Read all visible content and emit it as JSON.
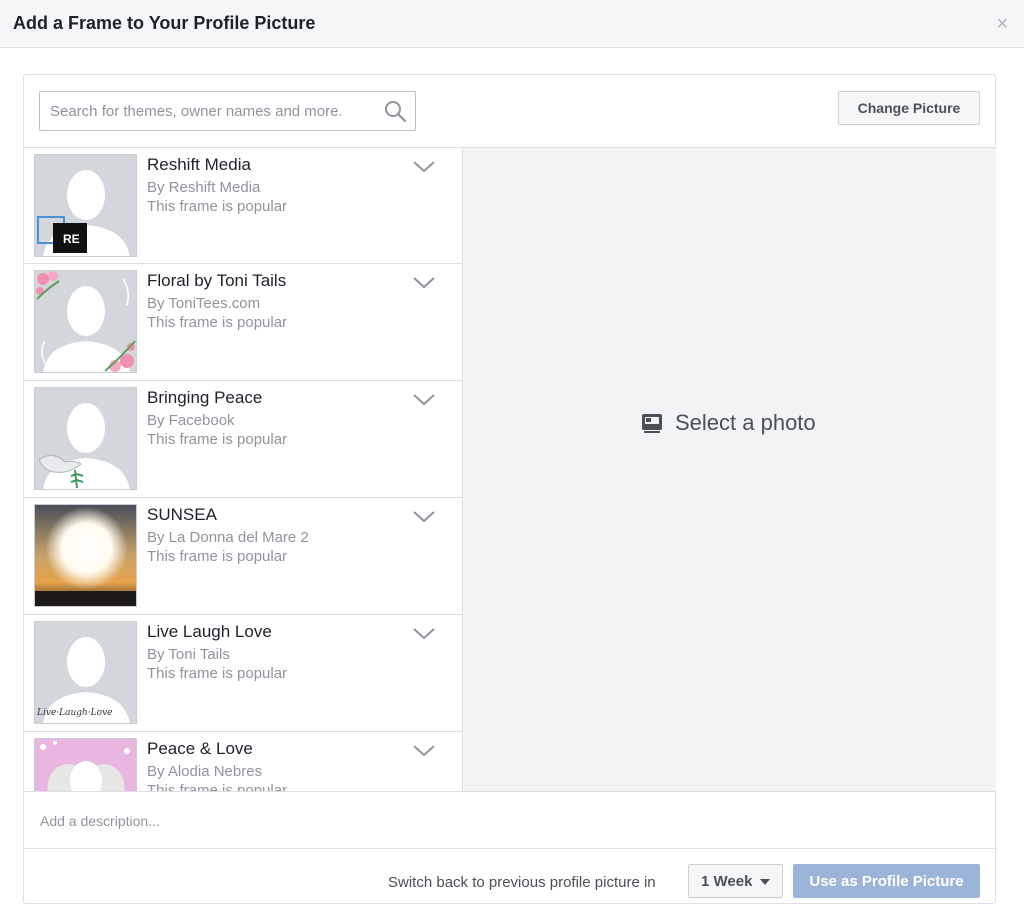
{
  "dialog": {
    "title": "Add a Frame to Your Profile Picture",
    "close_label": "×"
  },
  "search": {
    "placeholder": "Search for themes, owner names and more."
  },
  "toolbar": {
    "change_picture_label": "Change Picture"
  },
  "frames": [
    {
      "name": "Reshift Media",
      "owner": "By Reshift Media",
      "popularity": "This frame is popular",
      "thumb_text": "RE"
    },
    {
      "name": "Floral by Toni Tails",
      "owner": "By ToniTees.com",
      "popularity": "This frame is popular"
    },
    {
      "name": "Bringing Peace",
      "owner": "By Facebook",
      "popularity": "This frame is popular"
    },
    {
      "name": "SUNSEA",
      "owner": "By La Donna del Mare 2",
      "popularity": "This frame is popular"
    },
    {
      "name": "Live Laugh Love",
      "owner": "By Toni Tails",
      "popularity": "This frame is popular",
      "thumb_text": "Live·Laugh·Love"
    },
    {
      "name": "Peace & Love",
      "owner": "By Alodia Nebres",
      "popularity": "This frame is popular"
    }
  ],
  "preview": {
    "select_label": "Select a photo"
  },
  "description": {
    "placeholder": "Add a description..."
  },
  "footer": {
    "switch_text": "Switch back to previous profile picture in",
    "duration_value": "1 Week",
    "use_label": "Use as Profile Picture"
  },
  "colors": {
    "accent_disabled": "#9cb4d8",
    "preview_bg": "#f2f3f5",
    "border": "#dddfe2"
  }
}
